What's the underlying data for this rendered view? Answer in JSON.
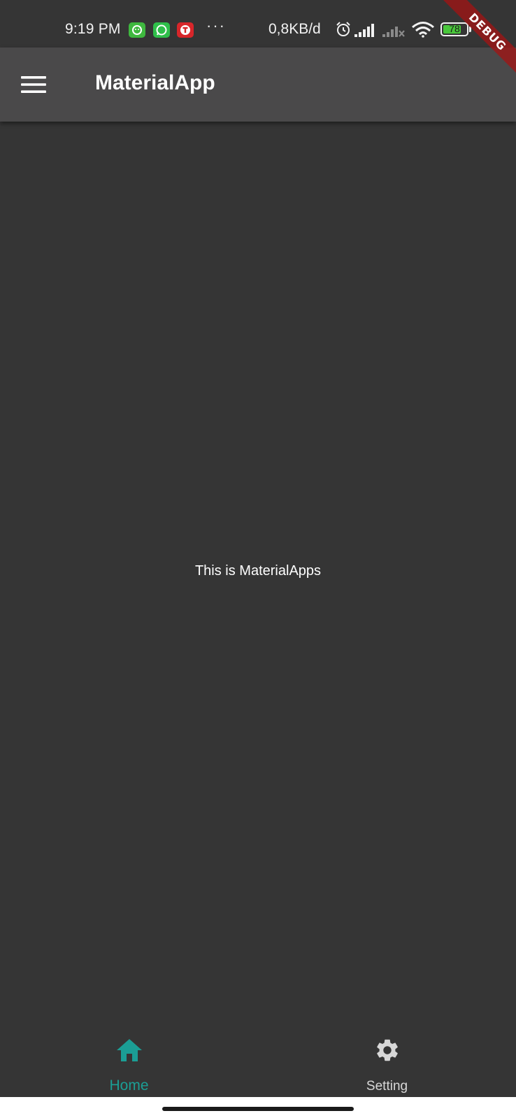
{
  "status_bar": {
    "time": "9:19 PM",
    "more": "···",
    "net_speed": "0,8KB/d",
    "battery_level": "78",
    "battery_fraction": 0.78,
    "notification_icons": [
      "game-app-icon",
      "whatsapp-icon",
      "telkomsel-app-icon"
    ]
  },
  "debug_banner": {
    "label": "DEBUG"
  },
  "app_bar": {
    "title": "MaterialApp",
    "menu_icon": "hamburger-menu-icon"
  },
  "body": {
    "text": "This is MaterialApps"
  },
  "bottom_nav": {
    "items": [
      {
        "label": "Home",
        "icon": "home-icon",
        "selected": true
      },
      {
        "label": "Setting",
        "icon": "settings-gear-icon",
        "selected": false
      }
    ]
  },
  "colors": {
    "background": "#353535",
    "app_bar": "#4a494a",
    "accent": "#1b9e95",
    "text": "#ffffff",
    "inactive": "#d8d8d8",
    "debug_banner": "#a01414"
  }
}
